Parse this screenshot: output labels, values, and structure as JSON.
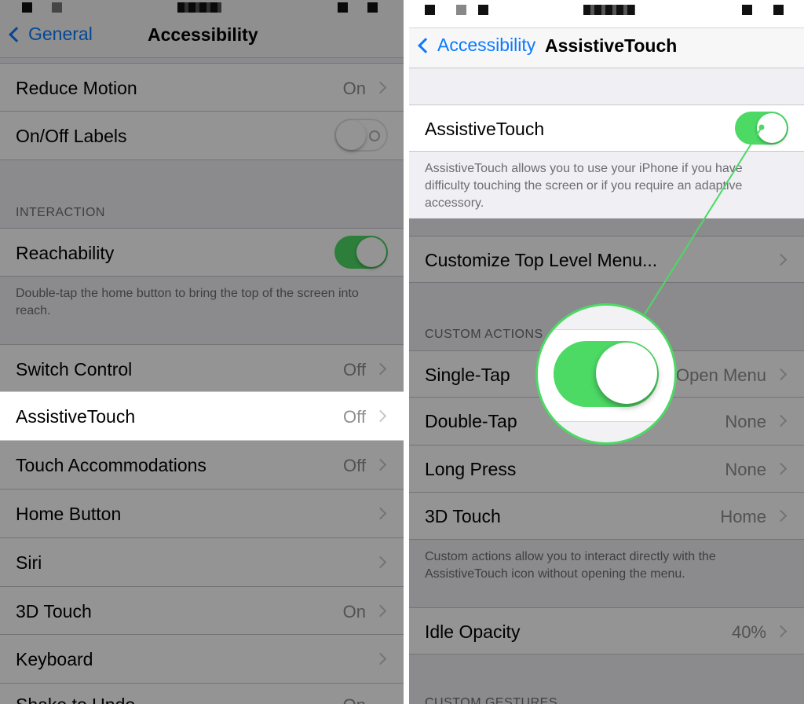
{
  "left": {
    "nav": {
      "back_label": "General",
      "title": "Accessibility"
    },
    "rows_top": [
      {
        "label": "Reduce Motion",
        "value": "On"
      },
      {
        "label": "On/Off Labels"
      }
    ],
    "interaction_header": "INTERACTION",
    "reachability": {
      "label": "Reachability",
      "footer": "Double-tap the home button to bring the top of the screen into reach."
    },
    "rows": [
      {
        "label": "Switch Control",
        "value": "Off"
      },
      {
        "label": "AssistiveTouch",
        "value": "Off"
      },
      {
        "label": "Touch Accommodations",
        "value": "Off"
      },
      {
        "label": "Home Button",
        "value": ""
      },
      {
        "label": "Siri",
        "value": ""
      },
      {
        "label": "3D Touch",
        "value": "On"
      },
      {
        "label": "Keyboard",
        "value": ""
      },
      {
        "label": "Shake to Undo",
        "value": "On"
      }
    ]
  },
  "right": {
    "nav": {
      "back_label": "Accessibility",
      "title": "AssistiveTouch"
    },
    "assistive": {
      "label": "AssistiveTouch",
      "footer": "AssistiveTouch allows you to use your iPhone if you have difficulty touching the screen or if you require an adaptive accessory."
    },
    "customize_label": "Customize Top Level Menu...",
    "custom_actions_header": "CUSTOM ACTIONS",
    "actions": [
      {
        "label": "Single-Tap",
        "value": "Open Menu"
      },
      {
        "label": "Double-Tap",
        "value": "None"
      },
      {
        "label": "Long Press",
        "value": "None"
      },
      {
        "label": "3D Touch",
        "value": "Home"
      }
    ],
    "actions_footer": "Custom actions allow you to interact directly with the AssistiveTouch icon without opening the menu.",
    "idle_opacity": {
      "label": "Idle Opacity",
      "value": "40%"
    },
    "custom_gestures_header": "CUSTOM GESTURES"
  },
  "colors": {
    "accent": "#0a7aff",
    "toggle_on": "#4cd964",
    "highlight_line": "#4cd964"
  },
  "icons": {
    "back": "chevron-left-icon",
    "disclosure": "chevron-right-icon"
  }
}
